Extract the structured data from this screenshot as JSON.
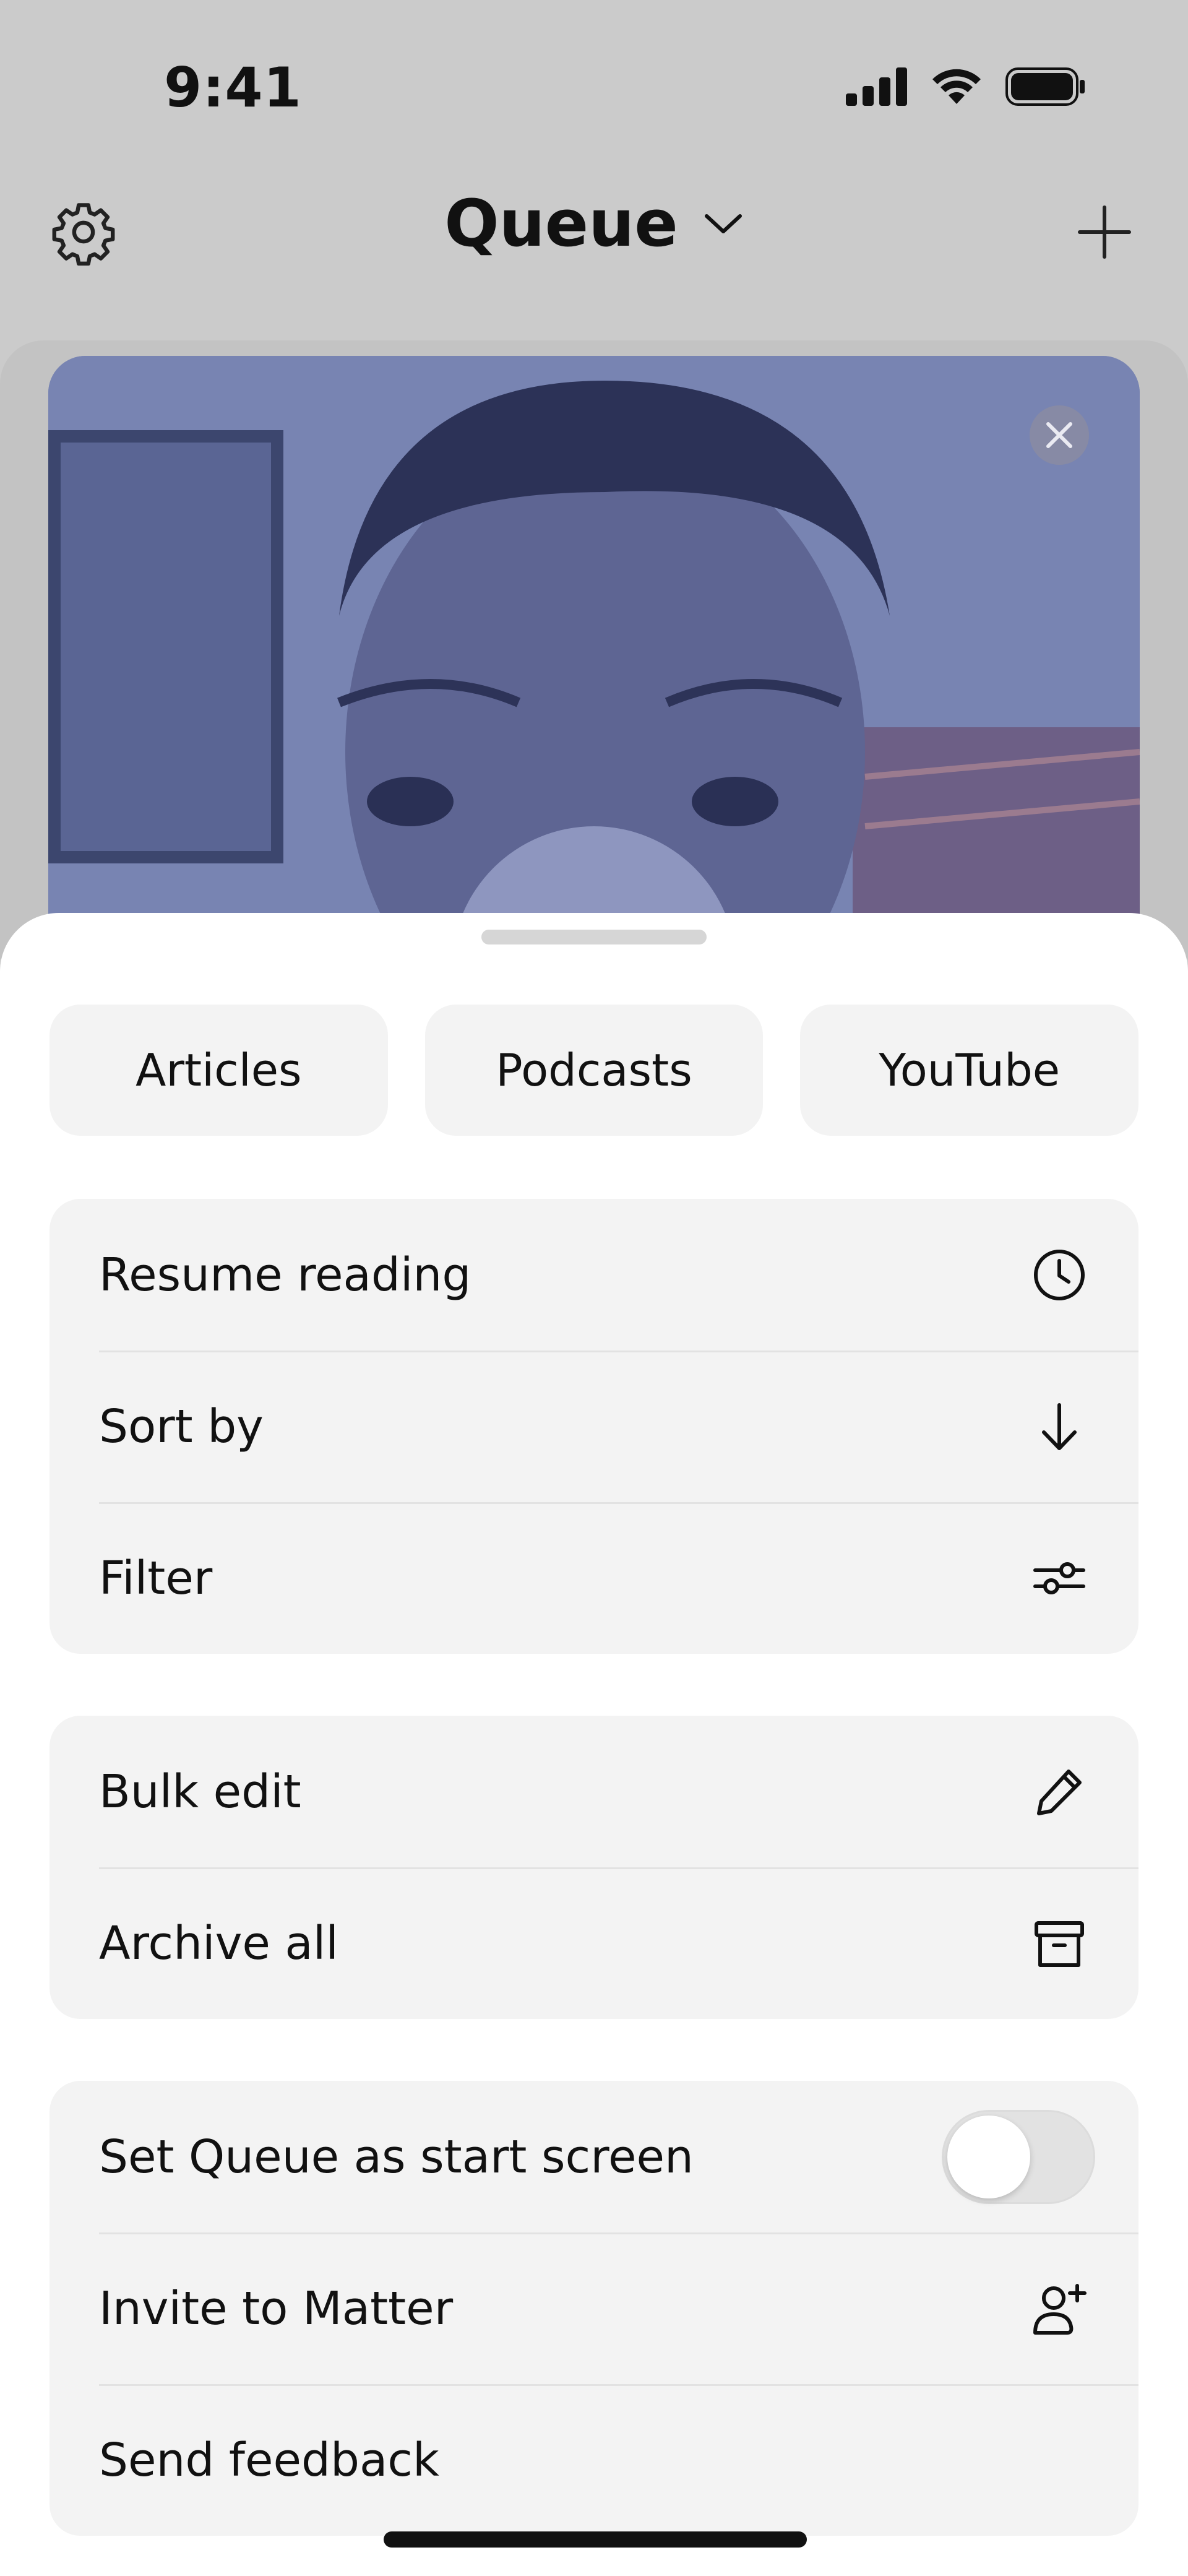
{
  "status_bar": {
    "time": "9:41"
  },
  "header": {
    "title": "Queue"
  },
  "sheet": {
    "tabs": [
      {
        "label": "Articles"
      },
      {
        "label": "Podcasts"
      },
      {
        "label": "YouTube"
      }
    ],
    "group1": [
      {
        "label": "Resume reading",
        "icon": "clock-icon"
      },
      {
        "label": "Sort by",
        "icon": "arrow-down-icon"
      },
      {
        "label": "Filter",
        "icon": "sliders-icon"
      }
    ],
    "group2": [
      {
        "label": "Bulk edit",
        "icon": "pencil-icon"
      },
      {
        "label": "Archive all",
        "icon": "archive-box-icon"
      }
    ],
    "group3": [
      {
        "label": "Set Queue as start screen",
        "toggle_on": false
      },
      {
        "label": "Invite to Matter",
        "icon": "add-user-icon"
      },
      {
        "label": "Send feedback"
      }
    ]
  },
  "colors": {
    "sheet_bg": "#ffffff",
    "group_bg": "#f3f3f3",
    "dimmed_bg": "#cbcbcb",
    "video_tint": "#7a86b4"
  }
}
